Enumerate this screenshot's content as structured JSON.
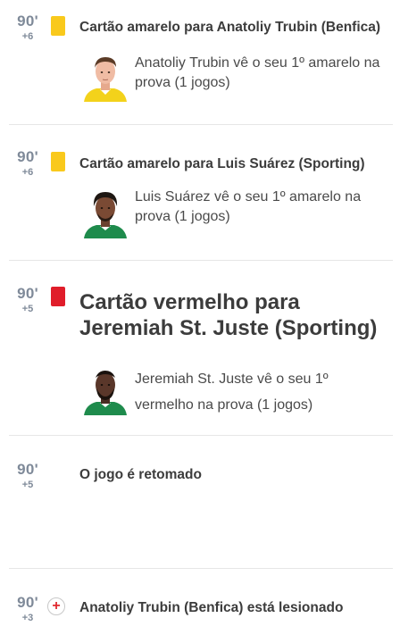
{
  "colors": {
    "yellow_card": "#f9c91c",
    "red_card": "#e01d2a",
    "minute_text": "#7f8a99",
    "injury_cross": "#e0282e",
    "benfica_kit": "#f3d21b",
    "sporting_kit": "#1e8b4c"
  },
  "events": [
    {
      "minute": "90'",
      "added": "+6",
      "icon": "yellow-card-icon",
      "title": "Cartão amarelo para Anatoliy Trubin (Benfica)",
      "player_avatar": "anatoliy-trubin-avatar",
      "description": "Anatoliy Trubin vê o seu 1º amarelo na prova (1 jogos)"
    },
    {
      "minute": "90'",
      "added": "+6",
      "icon": "yellow-card-icon",
      "title": "Cartão amarelo para Luis Suárez (Sporting)",
      "player_avatar": "luis-suarez-avatar",
      "description": "Luis Suárez vê o seu 1º amarelo na prova (1 jogos)"
    },
    {
      "minute": "90'",
      "added": "+5",
      "icon": "red-card-icon",
      "title": "Cartão vermelho para Jeremiah St. Juste (Sporting)",
      "player_avatar": "jeremiah-st-juste-avatar",
      "description": "Jeremiah St. Juste vê o seu 1º vermelho na prova (1 jogos)"
    },
    {
      "minute": "90'",
      "added": "+5",
      "icon": "",
      "title": "O jogo é retomado"
    },
    {
      "minute": "90'",
      "added": "+3",
      "icon": "injury-icon",
      "title": "Anatoliy Trubin (Benfica) está lesionado"
    }
  ]
}
